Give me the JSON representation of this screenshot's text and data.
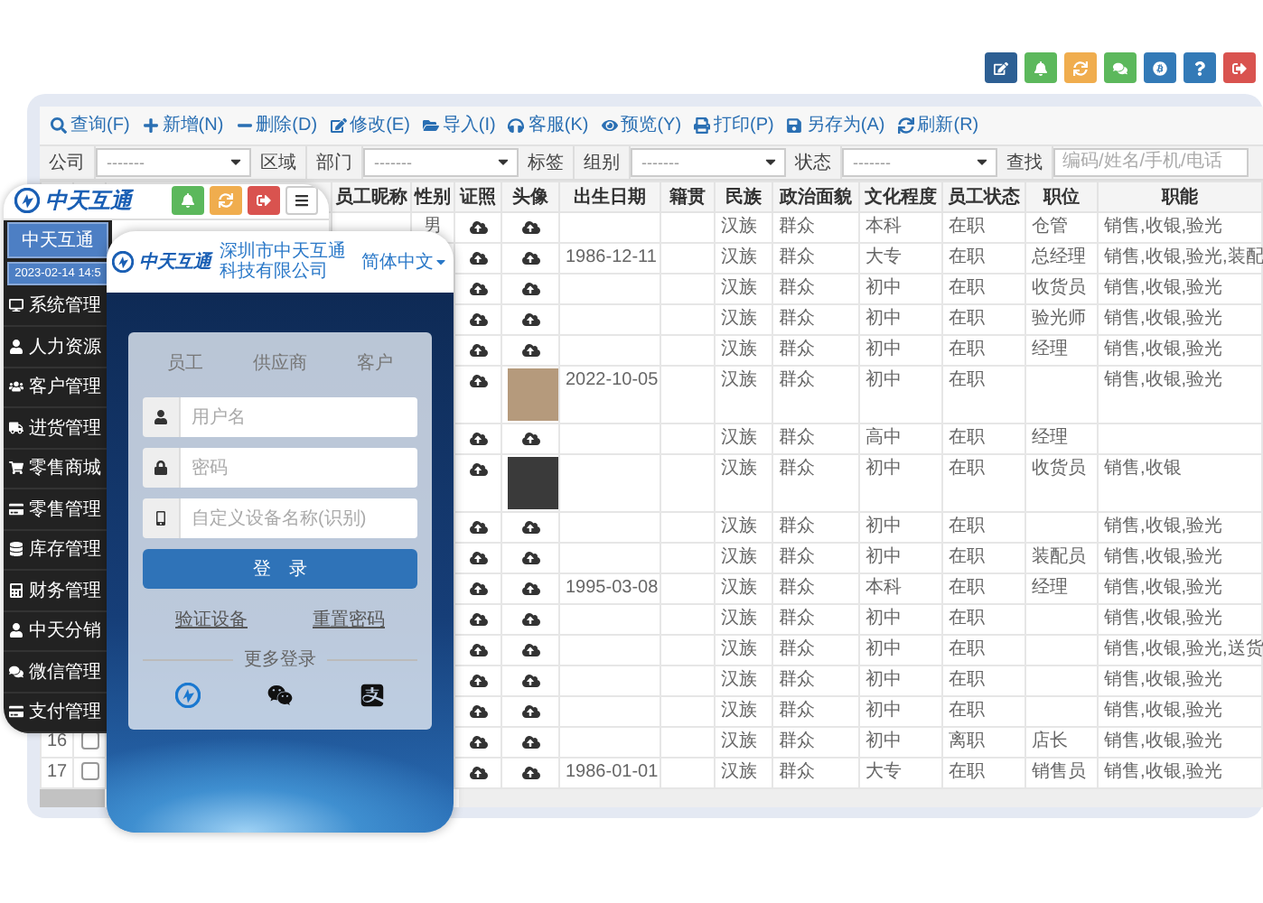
{
  "desktop": {
    "toolbar": [
      "查询(F)",
      "新增(N)",
      "删除(D)",
      "修改(E)",
      "导入(I)",
      "客服(K)",
      "预览(Y)",
      "打印(P)",
      "另存为(A)",
      "刷新(R)"
    ],
    "filters": [
      {
        "kind": "label",
        "text": "公司"
      },
      {
        "kind": "select",
        "value": "-------"
      },
      {
        "kind": "label",
        "text": "区域"
      },
      {
        "kind": "label",
        "text": "部门"
      },
      {
        "kind": "select",
        "value": "-------"
      },
      {
        "kind": "label",
        "text": "标签"
      },
      {
        "kind": "label",
        "text": "组别"
      },
      {
        "kind": "select",
        "value": "-------"
      },
      {
        "kind": "label",
        "text": "状态"
      },
      {
        "kind": "select",
        "value": "-------"
      },
      {
        "kind": "label",
        "text": "查找"
      },
      {
        "kind": "search",
        "placeholder": "编码/姓名/手机/电话"
      }
    ],
    "table": {
      "columns": [
        "员工昵称",
        "性别",
        "证照",
        "头像",
        "出生日期",
        "籍贯",
        "民族",
        "政治面貌",
        "文化程度",
        "员工状态",
        "职位",
        "职能"
      ],
      "rows": [
        {
          "gender": "男",
          "has_photo": false,
          "ethnicity": "汉族",
          "political_status": "群众",
          "education": "本科",
          "status": "在职",
          "position": "仓管",
          "functions": "销售,收银,验光"
        },
        {
          "has_photo": false,
          "birth_date": "1986-12-11",
          "ethnicity": "汉族",
          "political_status": "群众",
          "education": "大专",
          "status": "在职",
          "position": "总经理",
          "functions": "销售,收银,验光,装配"
        },
        {
          "has_photo": false,
          "ethnicity": "汉族",
          "political_status": "群众",
          "education": "初中",
          "status": "在职",
          "position": "收货员",
          "functions": "销售,收银,验光"
        },
        {
          "has_photo": false,
          "ethnicity": "汉族",
          "political_status": "群众",
          "education": "初中",
          "status": "在职",
          "position": "验光师",
          "functions": "销售,收银,验光"
        },
        {
          "has_photo": false,
          "ethnicity": "汉族",
          "political_status": "群众",
          "education": "初中",
          "status": "在职",
          "position": "经理",
          "functions": "销售,收银,验光"
        },
        {
          "has_photo": true,
          "birth_date": "2022-10-05",
          "ethnicity": "汉族",
          "political_status": "群众",
          "education": "初中",
          "status": "在职",
          "functions": "销售,收银,验光"
        },
        {
          "has_photo": false,
          "ethnicity": "汉族",
          "political_status": "群众",
          "education": "高中",
          "status": "在职",
          "position": "经理"
        },
        {
          "has_photo": true,
          "ethnicity": "汉族",
          "political_status": "群众",
          "education": "初中",
          "status": "在职",
          "position": "收货员",
          "functions": "销售,收银"
        },
        {
          "has_photo": false,
          "ethnicity": "汉族",
          "political_status": "群众",
          "education": "初中",
          "status": "在职",
          "functions": "销售,收银,验光"
        },
        {
          "has_photo": false,
          "ethnicity": "汉族",
          "political_status": "群众",
          "education": "初中",
          "status": "在职",
          "position": "装配员",
          "functions": "销售,收银,验光"
        },
        {
          "has_photo": false,
          "birth_date": "1995-03-08",
          "ethnicity": "汉族",
          "political_status": "群众",
          "education": "本科",
          "status": "在职",
          "position": "经理",
          "functions": "销售,收银,验光"
        },
        {
          "has_photo": false,
          "ethnicity": "汉族",
          "political_status": "群众",
          "education": "初中",
          "status": "在职",
          "functions": "销售,收银,验光"
        },
        {
          "has_photo": false,
          "ethnicity": "汉族",
          "political_status": "群众",
          "education": "初中",
          "status": "在职",
          "functions": "销售,收银,验光,送货"
        },
        {
          "has_photo": false,
          "ethnicity": "汉族",
          "political_status": "群众",
          "education": "初中",
          "status": "在职",
          "functions": "销售,收银,验光"
        },
        {
          "has_photo": false,
          "ethnicity": "汉族",
          "political_status": "群众",
          "education": "初中",
          "status": "在职",
          "functions": "销售,收银,验光"
        },
        {
          "number": "16",
          "checked": false,
          "has_photo": false,
          "ethnicity": "汉族",
          "political_status": "群众",
          "education": "初中",
          "status": "离职",
          "position": "店长",
          "functions": "销售,收银,验光"
        },
        {
          "number": "17",
          "checked": false,
          "has_photo": false,
          "birth_date": "1986-01-01",
          "ethnicity": "汉族",
          "political_status": "群众",
          "education": "大专",
          "status": "在职",
          "position": "销售员",
          "functions": "销售,收银,验光"
        }
      ]
    }
  },
  "tablet": {
    "logo": "中天互通",
    "info": [
      "中天互通",
      "2023-02-14 14:5"
    ],
    "menu": [
      "系统管理",
      "人力资源",
      "客户管理",
      "进货管理",
      "零售商城",
      "零售管理",
      "库存管理",
      "财务管理",
      "中天分销",
      "微信管理",
      "支付管理"
    ]
  },
  "phone": {
    "logo": "中天互通",
    "company": "深圳市中天互通科技有限公司",
    "language": "简体中文",
    "tabs": [
      "员工",
      "供应商",
      "客户"
    ],
    "fields": [
      {
        "placeholder": "用户名"
      },
      {
        "placeholder": "密码"
      },
      {
        "placeholder": "自定义设备名称(识别)"
      }
    ],
    "login_button": "登　录",
    "links": [
      "验证设备",
      "重置密码"
    ],
    "more_login": "更多登录"
  }
}
